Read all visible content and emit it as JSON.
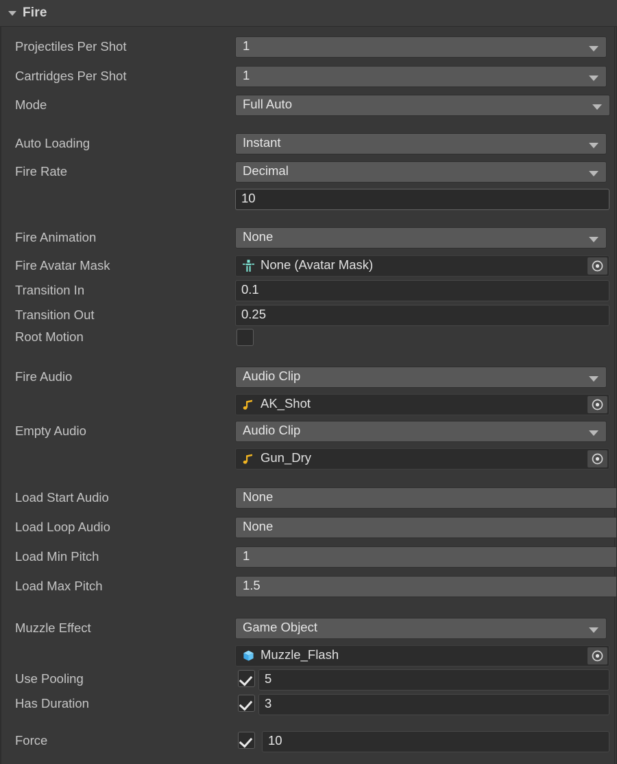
{
  "header": {
    "title": "Fire",
    "expanded": true,
    "foldout_icon": "chevron-down-icon"
  },
  "colors": {
    "panel_bg": "#383838",
    "header_bg": "#3c3c3c",
    "dropdown_bg": "#585858",
    "textfield_bg": "#2a2a2a",
    "objectfield_bg": "#2c2c2c",
    "label_text": "#c4c4c4",
    "value_text": "#e6e6e6",
    "audio_icon": "#f0b422",
    "gameobject_icon": "#5fc0f0",
    "avatarmask_icon": "#7fe8d8"
  },
  "rows": [
    {
      "label": "Projectiles Per Shot",
      "value": "1",
      "control": "dropdown"
    },
    {
      "label": "Cartridges Per Shot",
      "value": "1",
      "control": "dropdown"
    },
    {
      "label": "Mode",
      "value": "Full Auto",
      "control": "dropdown"
    },
    {
      "label": "Auto Loading",
      "value": "Instant",
      "control": "dropdown"
    },
    {
      "label": "Fire Rate",
      "value": "Decimal",
      "control": "dropdown"
    },
    {
      "label": "",
      "value": "10",
      "control": "textfield"
    },
    {
      "label": "Fire Animation",
      "value": "None",
      "control": "dropdown"
    },
    {
      "label": "Fire Avatar Mask",
      "value": "None (Avatar Mask)",
      "control": "objectfield",
      "icon": "avatar-mask-icon"
    },
    {
      "label": "Transition In",
      "value": "0.1",
      "control": "textfield"
    },
    {
      "label": "Transition Out",
      "value": "0.25",
      "control": "textfield"
    },
    {
      "label": "Root Motion",
      "value": "",
      "control": "checkbox",
      "checked": false
    },
    {
      "label": "Fire Audio",
      "value": "Audio Clip",
      "control": "dropdown"
    },
    {
      "label": "",
      "value": "AK_Shot",
      "control": "objectfield",
      "icon": "audio-clip-icon"
    },
    {
      "label": "Empty Audio",
      "value": "Audio Clip",
      "control": "dropdown"
    },
    {
      "label": "",
      "value": "Gun_Dry",
      "control": "objectfield",
      "icon": "audio-clip-icon"
    },
    {
      "label": "Load Start Audio",
      "value": "None",
      "control": "dropdown"
    },
    {
      "label": "Load Loop Audio",
      "value": "None",
      "control": "dropdown"
    },
    {
      "label": "Load Min Pitch",
      "value": "1",
      "control": "dropdown"
    },
    {
      "label": "Load Max Pitch",
      "value": "1.5",
      "control": "dropdown"
    },
    {
      "label": "Muzzle Effect",
      "value": "Game Object",
      "control": "dropdown"
    },
    {
      "label": "",
      "value": "Muzzle_Flash",
      "control": "objectfield",
      "icon": "game-object-icon"
    },
    {
      "label": "Use Pooling",
      "value": "5",
      "control": "checkbox-field",
      "checked": true
    },
    {
      "label": "Has Duration",
      "value": "3",
      "control": "checkbox-field",
      "checked": true
    },
    {
      "label": "Force",
      "value": "10",
      "control": "checkbox-field",
      "checked": true
    }
  ],
  "field_labels": {
    "projectiles_per_shot": "Projectiles Per Shot",
    "cartridges_per_shot": "Cartridges Per Shot",
    "mode": "Mode",
    "auto_loading": "Auto Loading",
    "fire_rate": "Fire Rate",
    "fire_rate_value": "10",
    "fire_animation": "Fire Animation",
    "fire_avatar_mask": "Fire Avatar Mask",
    "fire_avatar_mask_value": "None (Avatar Mask)",
    "transition_in": "Transition In",
    "transition_in_value": "0.1",
    "transition_out": "Transition Out",
    "transition_out_value": "0.25",
    "root_motion": "Root Motion",
    "fire_audio": "Fire Audio",
    "fire_audio_type": "Audio Clip",
    "fire_audio_clip": "AK_Shot",
    "empty_audio": "Empty Audio",
    "empty_audio_type": "Audio Clip",
    "empty_audio_clip": "Gun_Dry",
    "load_start_audio": "Load Start Audio",
    "load_start_audio_value": "None",
    "load_loop_audio": "Load Loop Audio",
    "load_loop_audio_value": "None",
    "load_min_pitch": "Load Min Pitch",
    "load_min_pitch_value": "1",
    "load_max_pitch": "Load Max Pitch",
    "load_max_pitch_value": "1.5",
    "muzzle_effect": "Muzzle Effect",
    "muzzle_effect_type": "Game Object",
    "muzzle_effect_object": "Muzzle_Flash",
    "use_pooling": "Use Pooling",
    "use_pooling_value": "5",
    "has_duration": "Has Duration",
    "has_duration_value": "3",
    "force": "Force",
    "force_value": "10",
    "projectiles_per_shot_value": "1",
    "cartridges_per_shot_value": "1",
    "mode_value": "Full Auto",
    "auto_loading_value": "Instant",
    "fire_rate_type": "Decimal",
    "fire_animation_value": "None"
  }
}
